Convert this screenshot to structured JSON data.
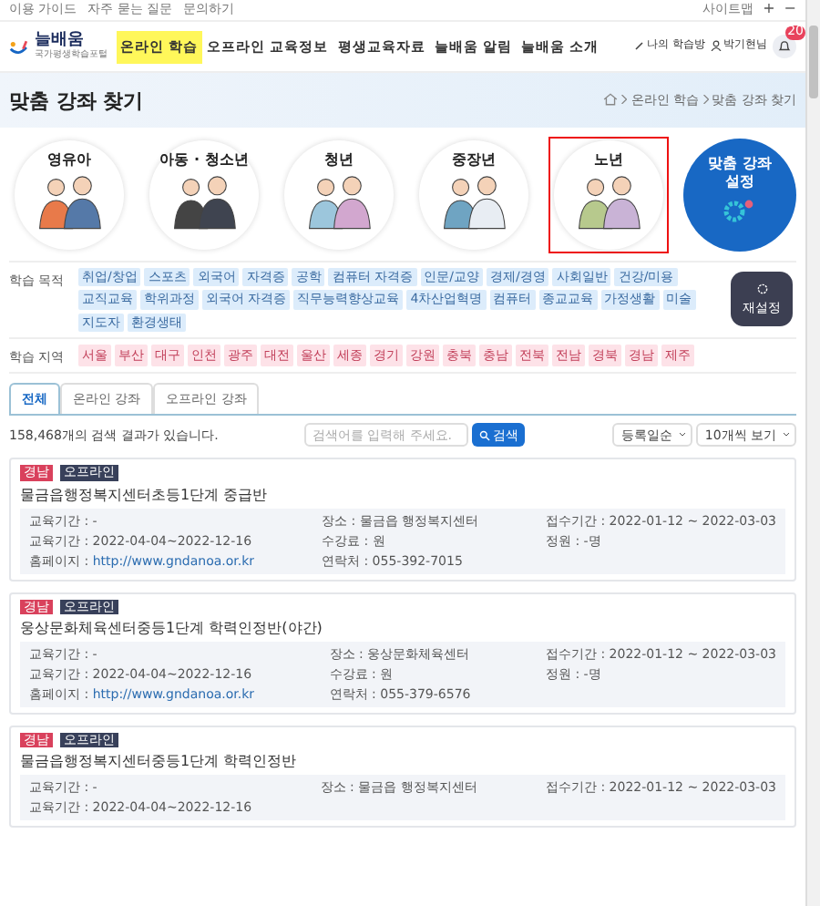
{
  "top_links": [
    "이용 가이드",
    "자주 묻는 질문",
    "문의하기"
  ],
  "top_right": {
    "sitemap": "사이트맵",
    "zoom_in": "+",
    "zoom_out": "−"
  },
  "logo": {
    "name": "늘배움",
    "subtitle": "국가평생학습포털"
  },
  "nav": [
    {
      "label": "온라인 학습",
      "selected": true
    },
    {
      "label": "오프라인 교육정보",
      "selected": false
    },
    {
      "label": "평생교육자료",
      "selected": false
    },
    {
      "label": "늘배움 알림",
      "selected": false
    },
    {
      "label": "늘배움 소개",
      "selected": false
    }
  ],
  "user_menu": {
    "my_learning": "나의 학습방",
    "user": "박기현님",
    "notifications": "20"
  },
  "page_title": "맞춤 강좌 찾기",
  "breadcrumb": [
    "온라인 학습",
    "맞춤 강좌 찾기"
  ],
  "age_groups": [
    {
      "label": "영유아",
      "selected": false
    },
    {
      "label": "아동 · 청소년",
      "selected": false
    },
    {
      "label": "청년",
      "selected": false
    },
    {
      "label": "중장년",
      "selected": false
    },
    {
      "label": "노년",
      "selected": true
    }
  ],
  "custom_setting": "맞춤 강좌 설정",
  "filters": [
    {
      "label": "학습 목적",
      "kind": "purpose",
      "tags": [
        "취업/창업",
        "스포츠",
        "외국어",
        "자격증",
        "공학",
        "컴퓨터 자격증",
        "인문/교양",
        "경제/경영",
        "사회일반",
        "건강/미용",
        "교직교육",
        "학위과정",
        "외국어 자격증",
        "직무능력향상교육",
        "4차산업혁명",
        "컴퓨터",
        "종교교육",
        "가정생활",
        "미술",
        "지도자",
        "환경생태"
      ]
    },
    {
      "label": "학습 지역",
      "kind": "region",
      "tags": [
        "서울",
        "부산",
        "대구",
        "인천",
        "광주",
        "대전",
        "울산",
        "세종",
        "경기",
        "강원",
        "충북",
        "충남",
        "전북",
        "전남",
        "경북",
        "경남",
        "제주"
      ]
    }
  ],
  "reset": "재설정",
  "tabs": [
    {
      "label": "전체",
      "selected": true
    },
    {
      "label": "온라인 강좌",
      "selected": false
    },
    {
      "label": "오프라인 강좌",
      "selected": false
    }
  ],
  "result_count": "158,468개의 검색 결과가 있습니다.",
  "search": {
    "placeholder": "검색어를 입력해 주세요.",
    "button": "검색"
  },
  "sort": "등록일순",
  "page_size": "10개씩 보기",
  "courses": [
    {
      "region": "경남",
      "type": "오프라인",
      "title": "물금읍행정복지센터초등1단계 중급반",
      "details": [
        {
          "text": "교육기간 : -"
        },
        {
          "text": "장소 : 물금읍 행정복지센터"
        },
        {
          "text": "접수기간 : 2022-01-12 ~ 2022-03-03"
        },
        {
          "text": "교육기간 : 2022-04-04~2022-12-16"
        },
        {
          "text": "수강료 : 원"
        },
        {
          "text": "정원 : -명"
        },
        {
          "text": "홈페이지 :",
          "link": "http://www.gndanoa.or.kr"
        },
        {
          "text": "연락처 : 055-392-7015"
        }
      ]
    },
    {
      "region": "경남",
      "type": "오프라인",
      "title": "웅상문화체육센터중등1단계 학력인정반(야간)",
      "details": [
        {
          "text": "교육기간 : -"
        },
        {
          "text": "장소 : 웅상문화체육센터"
        },
        {
          "text": "접수기간 : 2022-01-12 ~ 2022-03-03"
        },
        {
          "text": "교육기간 : 2022-04-04~2022-12-16"
        },
        {
          "text": "수강료 : 원"
        },
        {
          "text": "정원 : -명"
        },
        {
          "text": "홈페이지 :",
          "link": "http://www.gndanoa.or.kr"
        },
        {
          "text": "연락처 : 055-379-6576"
        }
      ]
    },
    {
      "region": "경남",
      "type": "오프라인",
      "title": "물금읍행정복지센터중등1단계 학력인정반",
      "details": [
        {
          "text": "교육기간 : -"
        },
        {
          "text": "장소 : 물금읍 행정복지센터"
        },
        {
          "text": "접수기간 : 2022-01-12 ~ 2022-03-03"
        },
        {
          "text": "교육기간 : 2022-04-04~2022-12-16"
        }
      ]
    }
  ]
}
